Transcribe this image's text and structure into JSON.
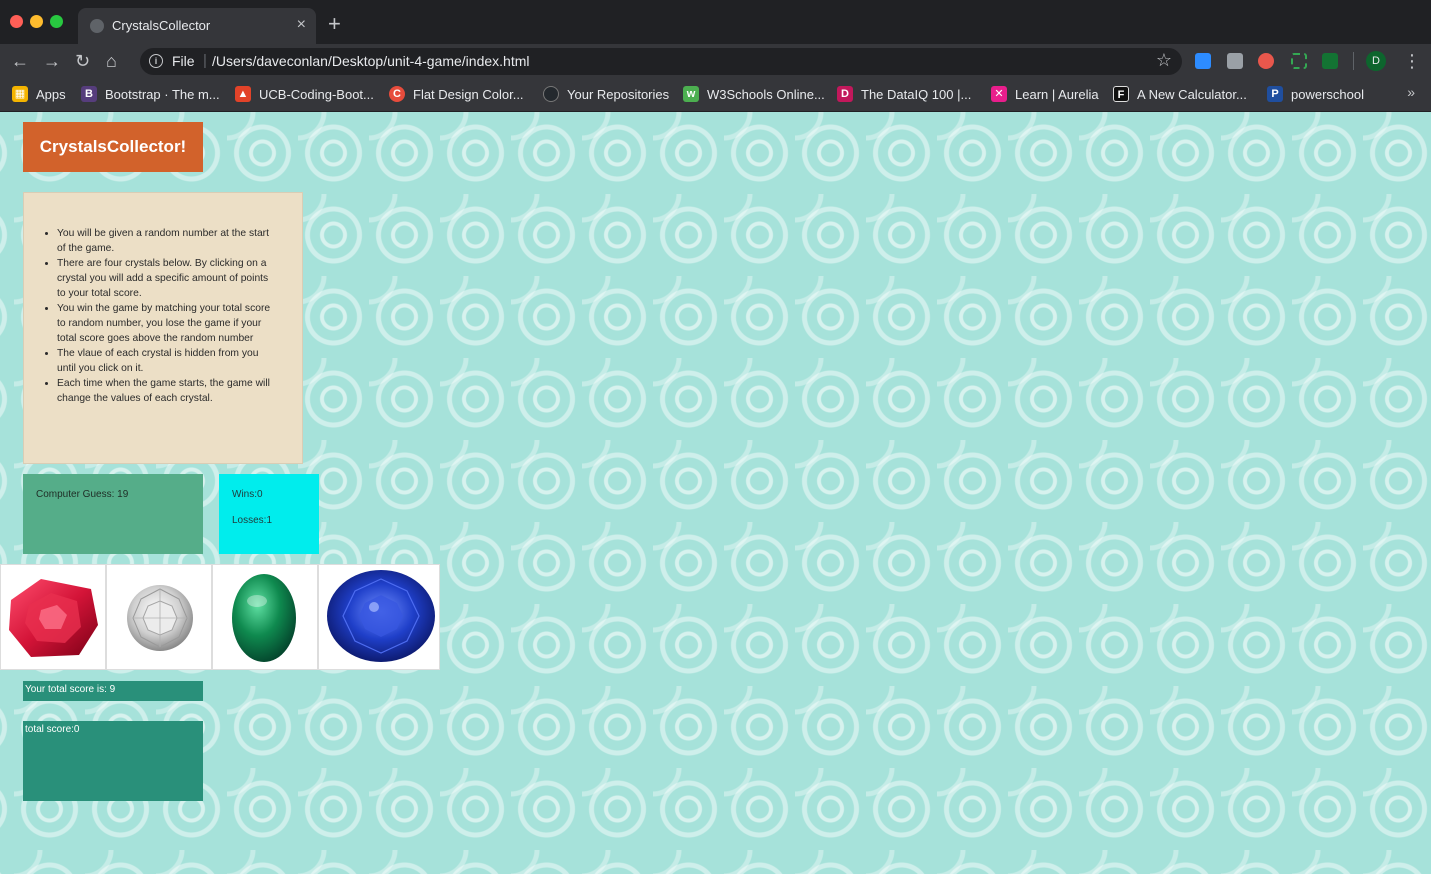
{
  "browser": {
    "tab_title": "CrystalsCollector",
    "tab_close": "×",
    "new_tab": "+",
    "url_scheme": "File",
    "url_separator": "|",
    "url_path": "/Users/daveconlan/Desktop/unit-4-game/index.html",
    "profile_initial": "D",
    "bookmarks": [
      {
        "label": "Apps",
        "icon": "apps-grid-icon",
        "color": "#f4b400"
      },
      {
        "label": "Bootstrap · The m...",
        "icon": "bootstrap-icon",
        "color": "#563d7c"
      },
      {
        "label": "UCB-Coding-Boot...",
        "icon": "gitlab-icon",
        "color": "#e24329"
      },
      {
        "label": "Flat Design Color...",
        "icon": "flatui-icon",
        "color": "#e74c3c"
      },
      {
        "label": "Your Repositories",
        "icon": "github-icon",
        "color": "#24292e"
      },
      {
        "label": "W3Schools Online...",
        "icon": "w3schools-icon",
        "color": "#4caf50"
      },
      {
        "label": "The DataIQ 100 |...",
        "icon": "dataiq-icon",
        "color": "#c2185b"
      },
      {
        "label": "Learn | Aurelia",
        "icon": "aurelia-icon",
        "color": "#e91e8c"
      },
      {
        "label": "A New Calculator...",
        "icon": "f-icon",
        "color": "#111111"
      },
      {
        "label": "powerschool",
        "icon": "powerschool-icon",
        "color": "#1f4e9e"
      }
    ],
    "bookmarks_more": "»"
  },
  "game": {
    "brand": "CrystalsCollector!",
    "instructions": [
      "You will be given a random number at the start of the game.",
      "There are four crystals below. By clicking on a crystal you will add a specific amount of points to your total score.",
      "You win the game by matching your total score to random number, you lose the game if your total score goes above the random number",
      "The vlaue of each crystal is hidden from you until you click on it.",
      "Each time when the game starts, the game will change the values of each crystal."
    ],
    "computer_guess": "Computer Guess: 19",
    "wins": "Wins:0",
    "losses": "Losses:1",
    "total_label": "Your total score is: 9",
    "total_score": "total score:0",
    "crystals": [
      {
        "name": "ruby",
        "color": "#d41438"
      },
      {
        "name": "diamond",
        "color": "#c9c9c9"
      },
      {
        "name": "emerald",
        "color": "#0f8a4f"
      },
      {
        "name": "sapphire",
        "color": "#1f3fc9"
      }
    ]
  },
  "colors": {
    "background": "#a6e2da",
    "brand": "#d2622b",
    "instructions_bg": "#ecdfc6",
    "guess_bg": "#55ad89",
    "score_bg": "#00eded",
    "total_bg": "#29907a"
  }
}
